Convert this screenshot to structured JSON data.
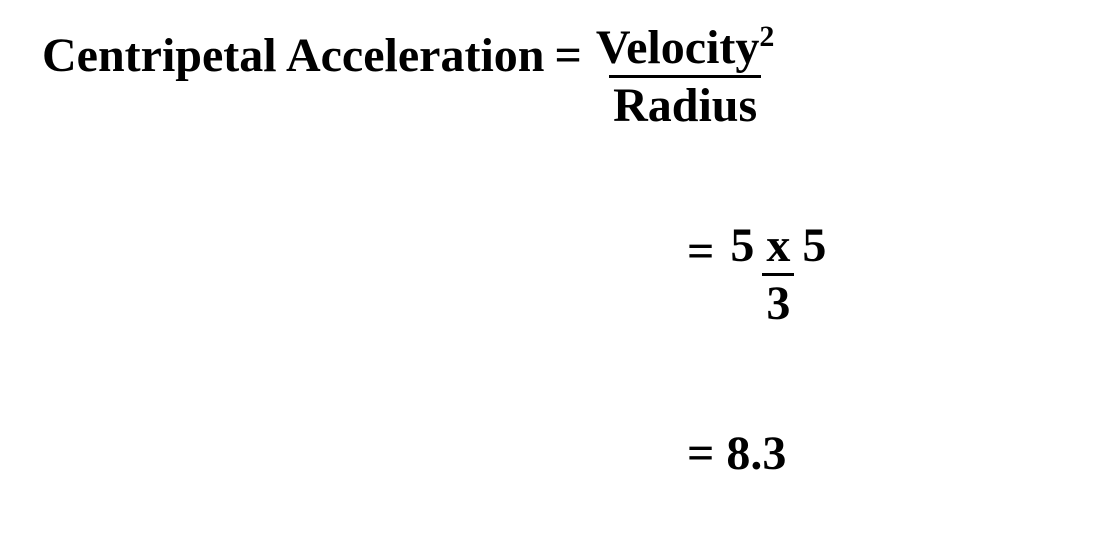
{
  "formula": {
    "lhs": "Centripetal Acceleration",
    "numerator_base": "Velocity",
    "numerator_exponent": "2",
    "denominator": "Radius"
  },
  "substitution": {
    "numerator": "5 x 5",
    "denominator": "3"
  },
  "result": "8.3",
  "symbols": {
    "equals": "="
  }
}
